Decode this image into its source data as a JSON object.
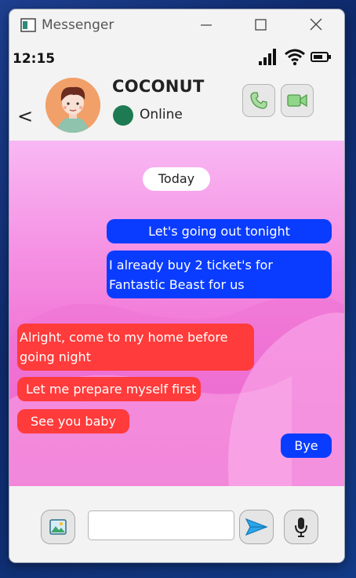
{
  "window": {
    "title": "Messenger"
  },
  "status_bar": {
    "time": "12:15"
  },
  "contact": {
    "name": "COCONUT",
    "status": "Online",
    "status_color": "#1e7a52"
  },
  "header": {
    "back_label": "<"
  },
  "chat": {
    "day_label": "Today",
    "messages": [
      {
        "direction": "out",
        "text": "Let's going out tonight"
      },
      {
        "direction": "out",
        "text": "I already buy 2 ticket's for Fantastic Beast for us"
      },
      {
        "direction": "in",
        "text": " Alright, come to my home before going night"
      },
      {
        "direction": "in",
        "text": "Let me prepare myself first"
      },
      {
        "direction": "in",
        "text": "See you baby"
      },
      {
        "direction": "out",
        "text": "Bye"
      }
    ]
  },
  "composer": {
    "value": "",
    "placeholder": ""
  },
  "colors": {
    "outgoing_bubble": "#0a3cff",
    "incoming_bubble": "#ff3b3b",
    "chat_background": "#f58ee2"
  },
  "icons": {
    "window": [
      "app-icon",
      "minimize-icon",
      "maximize-icon",
      "close-icon"
    ],
    "status": [
      "signal-icon",
      "wifi-icon",
      "battery-icon"
    ],
    "header": [
      "back-arrow-icon",
      "phone-icon",
      "video-camera-icon"
    ],
    "composer": [
      "image-icon",
      "send-icon",
      "microphone-icon"
    ]
  }
}
